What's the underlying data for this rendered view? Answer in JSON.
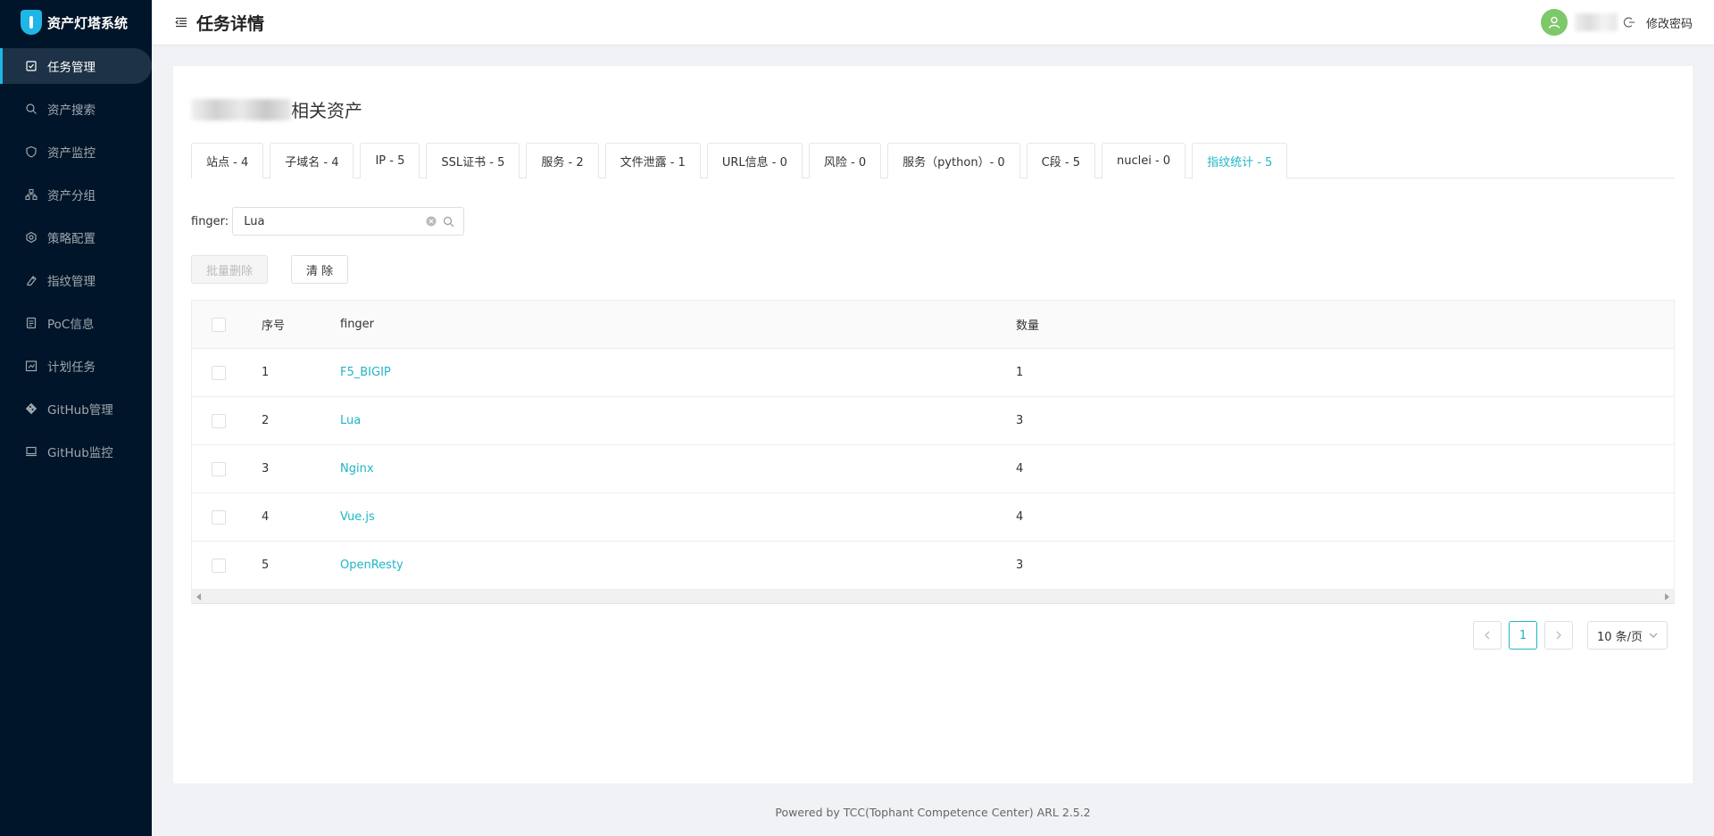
{
  "app": {
    "title": "资产灯塔系统"
  },
  "sidebar": {
    "items": [
      {
        "label": "任务管理",
        "icon": "task-icon",
        "active": true
      },
      {
        "label": "资产搜索",
        "icon": "search-icon",
        "active": false
      },
      {
        "label": "资产监控",
        "icon": "shield-icon",
        "active": false
      },
      {
        "label": "资产分组",
        "icon": "group-icon",
        "active": false
      },
      {
        "label": "策略配置",
        "icon": "settings-icon",
        "active": false
      },
      {
        "label": "指纹管理",
        "icon": "fingerprint-icon",
        "active": false
      },
      {
        "label": "PoC信息",
        "icon": "document-icon",
        "active": false
      },
      {
        "label": "计划任务",
        "icon": "calendar-icon",
        "active": false
      },
      {
        "label": "GitHub管理",
        "icon": "git-icon",
        "active": false
      },
      {
        "label": "GitHub监控",
        "icon": "monitor-icon",
        "active": false
      }
    ]
  },
  "header": {
    "title": "任务详情",
    "change_password": "修改密码"
  },
  "card": {
    "title_suffix": "相关资产"
  },
  "tabs": [
    {
      "label": "站点 - 4",
      "active": false
    },
    {
      "label": "子域名 - 4",
      "active": false
    },
    {
      "label": "IP - 5",
      "active": false
    },
    {
      "label": "SSL证书 - 5",
      "active": false
    },
    {
      "label": "服务 - 2",
      "active": false
    },
    {
      "label": "文件泄露 - 1",
      "active": false
    },
    {
      "label": "URL信息 - 0",
      "active": false
    },
    {
      "label": "风险 - 0",
      "active": false
    },
    {
      "label": "服务（python）- 0",
      "active": false
    },
    {
      "label": "C段 - 5",
      "active": false
    },
    {
      "label": "nuclei - 0",
      "active": false
    },
    {
      "label": "指纹统计 - 5",
      "active": true
    }
  ],
  "filter": {
    "label": "finger:",
    "value": "Lua"
  },
  "buttons": {
    "batch_delete": "批量删除",
    "clear": "清 除"
  },
  "table": {
    "headers": {
      "index": "序号",
      "finger": "finger",
      "count": "数量"
    },
    "rows": [
      {
        "index": "1",
        "finger": "F5_BIGIP",
        "count": "1"
      },
      {
        "index": "2",
        "finger": "Lua",
        "count": "3"
      },
      {
        "index": "3",
        "finger": "Nginx",
        "count": "4"
      },
      {
        "index": "4",
        "finger": "Vue.js",
        "count": "4"
      },
      {
        "index": "5",
        "finger": "OpenResty",
        "count": "3"
      }
    ]
  },
  "pagination": {
    "current_page": "1",
    "page_size": "10 条/页"
  },
  "footer": {
    "text": "Powered by TCC(Tophant Competence Center) ARL 2.5.2"
  },
  "colors": {
    "accent": "#1fb6c6",
    "sidebar_bg": "#001529",
    "avatar": "#7dc86a"
  }
}
